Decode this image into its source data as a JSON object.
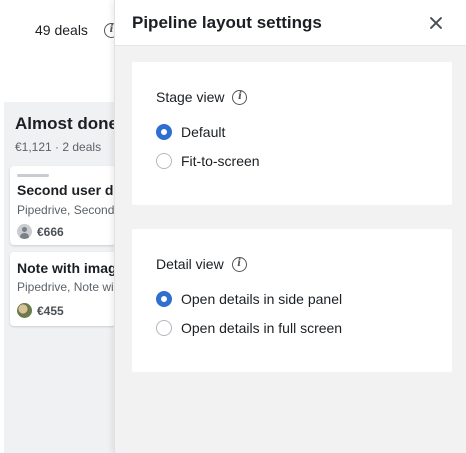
{
  "background": {
    "deals_count": "49 deals",
    "column": {
      "title": "Almost done",
      "subtitle": "€1,121 · 2 deals",
      "cards": [
        {
          "title": "Second user deal",
          "org": "Pipedrive, Second user",
          "value": "€666"
        },
        {
          "title": "Note with image",
          "org": "Pipedrive, Note with image",
          "value": "€455"
        }
      ]
    }
  },
  "panel": {
    "title": "Pipeline layout settings",
    "stage_view": {
      "label": "Stage view",
      "options": [
        "Default",
        "Fit-to-screen"
      ],
      "selected": "Default"
    },
    "detail_view": {
      "label": "Detail view",
      "options": [
        "Open details in side panel",
        "Open details in full screen"
      ],
      "selected": "Open details in side panel"
    }
  },
  "colors": {
    "accent": "#2f6fd1",
    "panel_bg": "#f2f2f3"
  }
}
